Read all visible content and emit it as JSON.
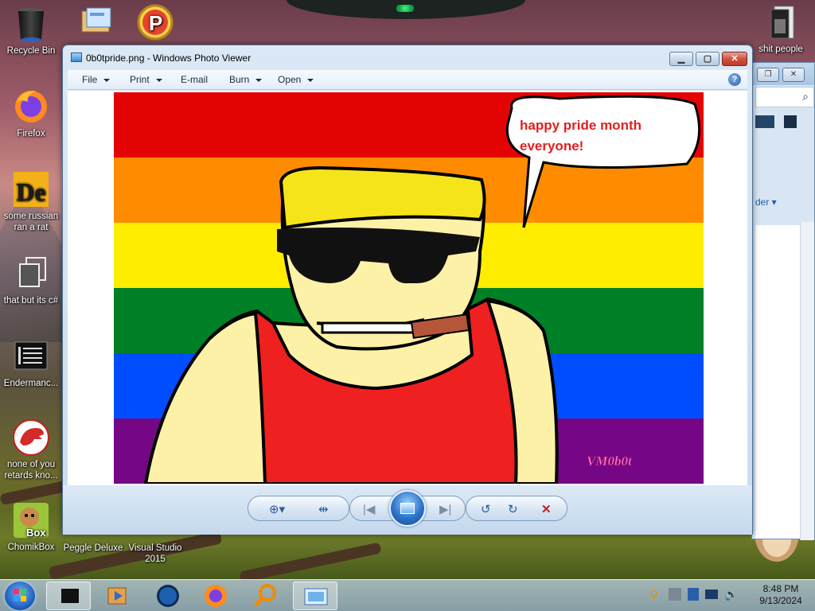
{
  "desktop": {
    "icons": [
      {
        "label": "Recycle Bin",
        "icon": "recycle-bin-icon"
      },
      {
        "label": "Firefox",
        "icon": "firefox-icon"
      },
      {
        "label": "some russian ran a rat",
        "icon": "app-de-icon"
      },
      {
        "label": "that but its c#",
        "icon": "copy-icon"
      },
      {
        "label": "Endermanc...",
        "icon": "notepad-icon"
      },
      {
        "label": "none of you retards kno...",
        "icon": "dinosaur-icon"
      },
      {
        "label": "ChomikBox",
        "icon": "hamster-box-icon"
      },
      {
        "label": "Peggle Deluxe",
        "icon": "peggle-icon"
      },
      {
        "label": "Visual Studio 2015",
        "icon": "visual-studio-icon"
      },
      {
        "label": "shit people",
        "icon": "folder-icon"
      },
      {
        "label": "",
        "icon": "mail-icon"
      },
      {
        "label": "",
        "icon": "peggle-p-icon"
      }
    ]
  },
  "photo_viewer": {
    "title": "0b0tpride.png - Windows Photo Viewer",
    "menu": [
      {
        "label": "File",
        "has_dropdown": true
      },
      {
        "label": "Print",
        "has_dropdown": true
      },
      {
        "label": "E-mail",
        "has_dropdown": false
      },
      {
        "label": "Burn",
        "has_dropdown": true
      },
      {
        "label": "Open",
        "has_dropdown": true
      }
    ],
    "help_label": "?",
    "image": {
      "speech": "happy pride month everyone!",
      "speech_line1": "happy pride month",
      "speech_line2": "everyone!",
      "signature": "VM0b0t",
      "flag_colors": [
        "#e40303",
        "#ff8c00",
        "#ffed00",
        "#008026",
        "#004dff",
        "#750787"
      ]
    },
    "toolbar": {
      "buttons": [
        "zoom-icon",
        "actual-size-icon",
        "previous-icon",
        "slideshow-icon",
        "next-icon",
        "rotate-left-icon",
        "rotate-right-icon",
        "delete-icon"
      ]
    }
  },
  "background_window": {
    "partial_text": "der"
  },
  "taskbar": {
    "time": "8:48 PM",
    "date": "9/13/2024",
    "pinned": [
      "start-orb",
      "media-player-icon",
      "globe-icon",
      "firefox-icon",
      "magnifier-icon",
      "photo-viewer-icon"
    ]
  }
}
